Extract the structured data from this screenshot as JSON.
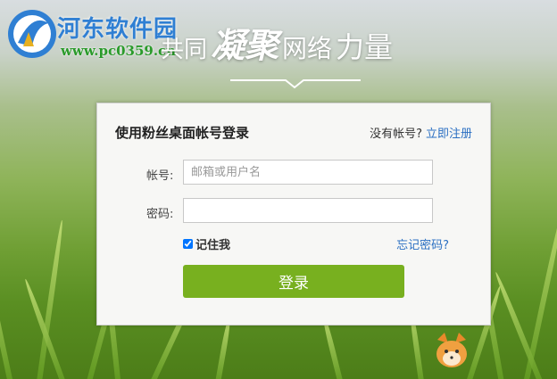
{
  "site": {
    "name": "河东软件园",
    "url": "www.pc0359.cn"
  },
  "slogan": {
    "part1": "共同",
    "part2": "凝聚",
    "part3": "网络",
    "part4": "力量"
  },
  "login": {
    "title": "使用粉丝桌面帐号登录",
    "no_account_text": "没有帐号?",
    "register_label": "立即注册",
    "account_label": "帐号:",
    "account_placeholder": "邮箱或用户名",
    "account_value": "",
    "password_label": "密码:",
    "password_value": "",
    "remember_label": "记住我",
    "remember_checked": true,
    "forgot_label": "忘记密码?",
    "submit_label": "登录"
  },
  "colors": {
    "accent_green": "#78b01f",
    "link_blue": "#2a6fc2",
    "site_name_blue": "#2f7fd3",
    "site_url_green": "#2a9a2a"
  },
  "icons": {
    "logo": "site-logo-icon",
    "watermark": "fox-mascot-icon"
  }
}
